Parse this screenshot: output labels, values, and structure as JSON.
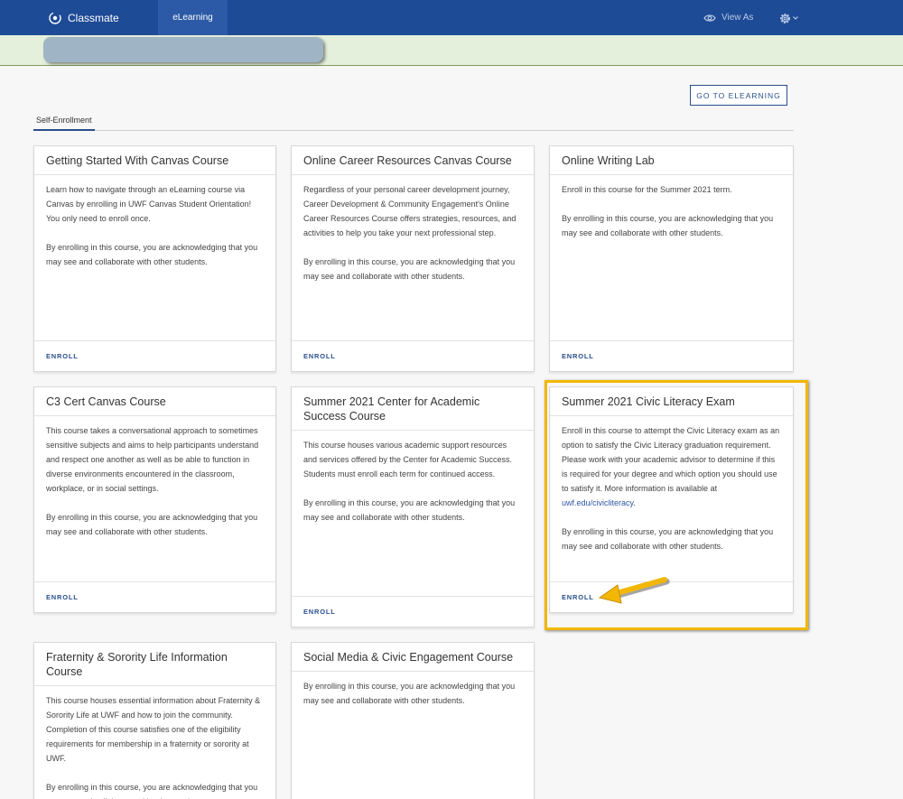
{
  "header": {
    "brand": "Classmate",
    "tab": "eLearning",
    "view_as": "View As",
    "icons": {
      "brand": "classmate-logo-icon",
      "view": "eye-icon",
      "settings": "gear-icon"
    }
  },
  "go_button": "GO TO ELEARNING",
  "tabs": {
    "active": "Self-Enrollment"
  },
  "enroll_label": "ENROLL",
  "colors": {
    "header": "#1e4b96",
    "accent": "#2a4f8c",
    "highlight": "#f2b705"
  },
  "cards": [
    {
      "title": "Getting Started With Canvas Course",
      "desc": "Learn how to navigate through an eLearning course via Canvas by enrolling in UWF Canvas Student Orientation! You only need to enroll once.",
      "note": "By enrolling in this course, you are acknowledging that you may see and collaborate with other students."
    },
    {
      "title": "Online Career Resources Canvas Course",
      "desc": "Regardless of your personal career development journey, Career Development & Community Engagement's Online Career Resources Course offers strategies, resources, and activities to help you take your next professional step.",
      "note": "By enrolling in this course, you are acknowledging that you may see and collaborate with other students."
    },
    {
      "title": "Online Writing Lab",
      "desc": "Enroll in this course for the Summer 2021 term.",
      "note": "By enrolling in this course, you are acknowledging that you may see and collaborate with other students."
    },
    {
      "title": "C3 Cert Canvas Course",
      "desc": "This course takes a conversational approach to sometimes sensitive subjects and aims to help participants understand and respect one another as well as be able to function in diverse environments encountered in the classroom, workplace, or in social settings.",
      "note": "By enrolling in this course, you are acknowledging that you may see and collaborate with other students."
    },
    {
      "title": "Summer 2021 Center for Academic Success Course",
      "desc": "This course houses various academic support resources and services offered by the Center for Academic Success. Students must enroll each term for continued access.",
      "note": "By enrolling in this course, you are acknowledging that you may see and collaborate with other students."
    },
    {
      "title": "Summer 2021 Civic Literacy Exam",
      "desc": "Enroll in this course to attempt the Civic Literacy exam as an option to satisfy the Civic Literacy graduation requirement. Please work with your academic advisor to determine if this is required for your degree and which option you should use to satisfy it. More information is available at",
      "link": "uwf.edu/civicliteracy",
      "note": "By enrolling in this course, you are acknowledging that you may see and collaborate with other students."
    },
    {
      "title": "Fraternity & Sorority Life Information Course",
      "desc": "This course houses essential information about Fraternity & Sorority Life at UWF and how to join the community. Completion of this course satisfies one of the eligibility requirements for membership in a fraternity or sorority at UWF.",
      "note": "By enrolling in this course, you are acknowledging that you may see and collaborate with other students."
    },
    {
      "title": "Social Media & Civic Engagement Course",
      "note": "By enrolling in this course, you are acknowledging that you may see and collaborate with other students."
    }
  ]
}
